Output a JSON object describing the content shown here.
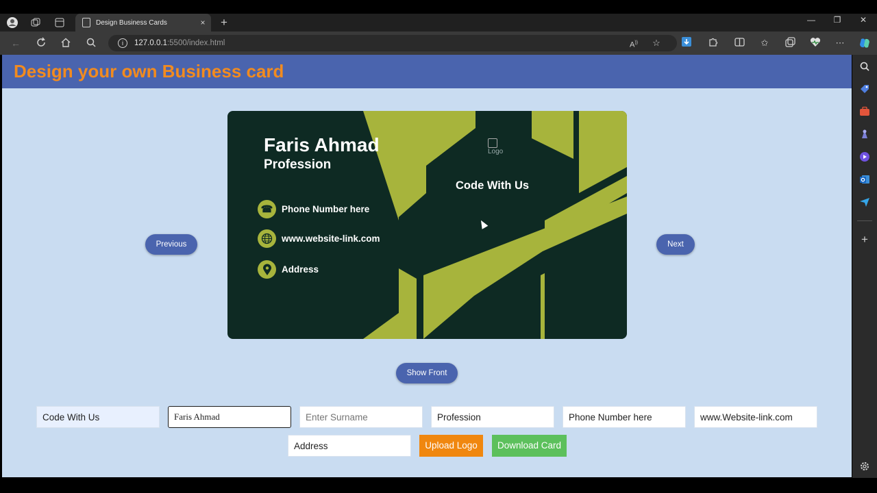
{
  "browser": {
    "tab_title": "Design Business Cards",
    "tab_close": "×",
    "new_tab": "+",
    "url_host": "127.0.0.1",
    "url_path": ":5500/index.html",
    "window_minimize": "—",
    "window_restore": "❐",
    "window_close": "✕"
  },
  "page": {
    "header_title": "Design your own Business card"
  },
  "card": {
    "name": "Faris Ahmad",
    "profession": "Profession",
    "phone": "Phone Number here",
    "website": "www.website-link.com",
    "address": "Address",
    "logo_alt": "Logo",
    "company": "Code With Us",
    "colors": {
      "background": "#0e2a23",
      "accent": "#a7b43c"
    }
  },
  "controls": {
    "previous_label": "Previous",
    "next_label": "Next",
    "show_front_label": "Show Front",
    "upload_logo_label": "Upload Logo",
    "download_card_label": "Download Card"
  },
  "inputs": {
    "company_value": "Code With Us",
    "name_value": "Faris Ahmad",
    "surname_placeholder": "Enter Surname",
    "profession_value": "Profession",
    "phone_value": "Phone Number here",
    "website_value": "www.Website-link.com",
    "address_value": "Address"
  },
  "colors": {
    "header_bg": "#4a64ae",
    "header_text": "#f28b1f",
    "page_bg": "#c9dcf1",
    "upload_button": "#f0870f",
    "download_button": "#5cc05c"
  }
}
